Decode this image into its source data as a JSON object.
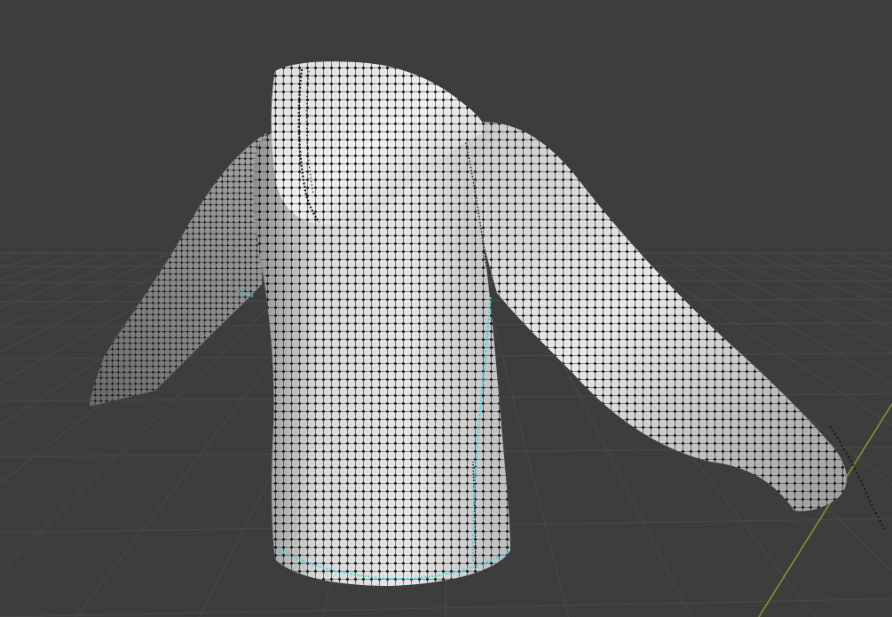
{
  "viewport": {
    "mode": "edit-mode-vertex-select",
    "object": "hoodie-mesh",
    "show_grid_floor": true,
    "show_y_axis": true
  },
  "colors": {
    "background": "#3d3d3d",
    "grid_line": "#4a4a4a",
    "y_axis": "#7e9c2a",
    "mesh_light": "#e4e4e4",
    "mesh_mid": "#a9a9a9",
    "mesh_dark": "#5e5e5e",
    "vertex": "#141414",
    "selected_edge": "#2fd9e0"
  }
}
